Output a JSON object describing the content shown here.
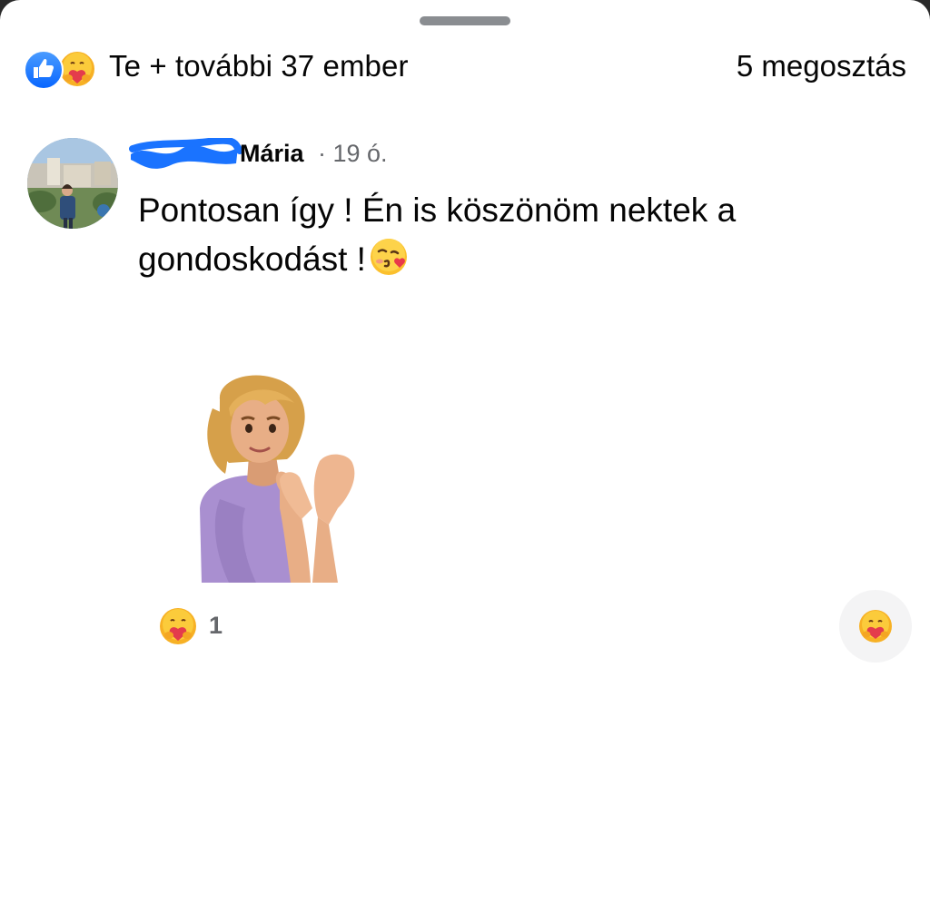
{
  "post": {
    "reactions_summary": "Te + további 37 ember",
    "shares": "5 megosztás",
    "reaction_icons": [
      "like-icon",
      "care-icon"
    ]
  },
  "comment": {
    "author": "Mária",
    "timestamp": "· 19 ó.",
    "text": "Pontosan így ! Én is köszönöm nektek a gondoskodást !",
    "text_emoji": "face-blowing-kiss-icon",
    "sticker": "clapping-avatar-sticker",
    "reaction_icon": "care-icon",
    "reaction_count": "1",
    "react_button_icon": "care-icon"
  },
  "colors": {
    "like_blue": "#0866ff",
    "secondary_text": "#65676b",
    "redaction_blue": "#1a73ff"
  }
}
